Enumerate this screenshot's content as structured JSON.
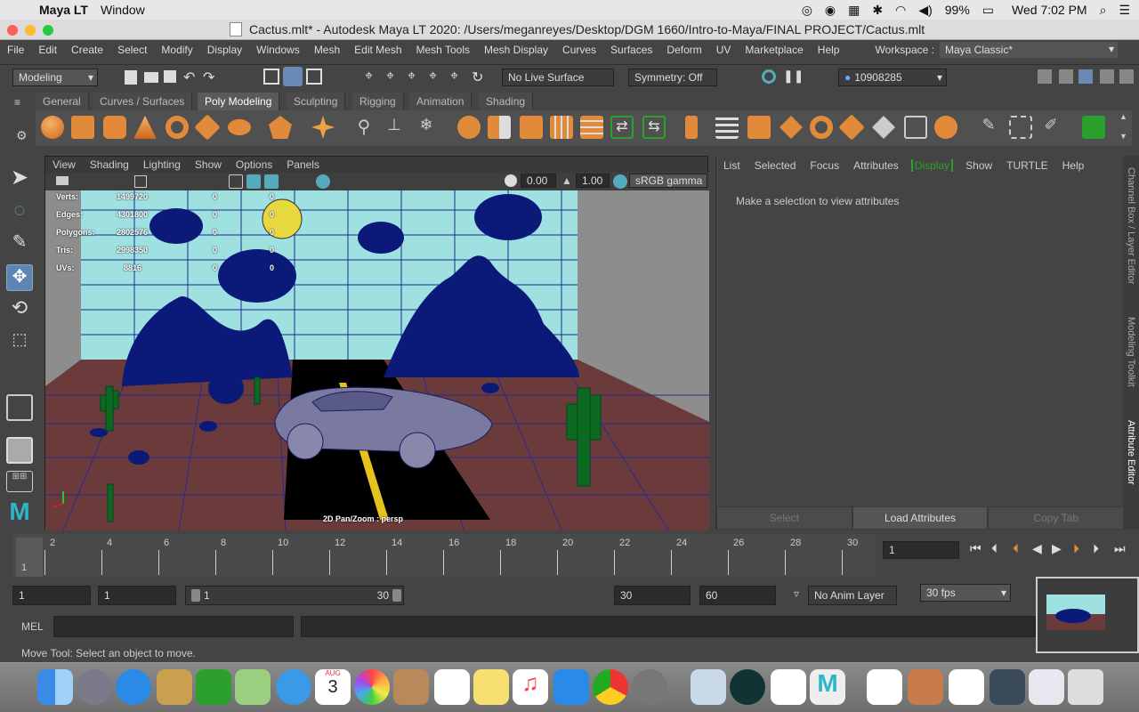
{
  "mac_menubar": {
    "apple": "",
    "app": "Maya LT",
    "window": "Window",
    "battery": "99%",
    "clock": "Wed 7:02 PM"
  },
  "window": {
    "title": "Cactus.mlt* - Autodesk Maya LT 2020: /Users/meganreyes/Desktop/DGM 1660/Intro-to-Maya/FINAL PROJECT/Cactus.mlt"
  },
  "menus": [
    "File",
    "Edit",
    "Create",
    "Select",
    "Modify",
    "Display",
    "Windows",
    "Mesh",
    "Edit Mesh",
    "Mesh Tools",
    "Mesh Display",
    "Curves",
    "Surfaces",
    "Deform",
    "UV",
    "Marketplace",
    "Help"
  ],
  "workspace": {
    "label": "Workspace :",
    "value": "Maya Classic*"
  },
  "status": {
    "mode": "Modeling",
    "live_surface": "No Live Surface",
    "symmetry": "Symmetry: Off",
    "user": "10908285"
  },
  "shelf_tabs": [
    "General",
    "Curves / Surfaces",
    "Poly Modeling",
    "Sculpting",
    "Rigging",
    "Animation",
    "Shading"
  ],
  "shelf_active": "Poly Modeling",
  "viewport": {
    "menus": [
      "View",
      "Shading",
      "Lighting",
      "Show",
      "Options",
      "Panels"
    ],
    "exposure": "0.00",
    "gamma": "1.00",
    "colorspace": "sRGB gamma",
    "hud": [
      {
        "label": "Verts:",
        "value": "1499720",
        "a": "0",
        "b": "0"
      },
      {
        "label": "Edges:",
        "value": "4301800",
        "a": "0",
        "b": "0"
      },
      {
        "label": "Polygons:",
        "value": "2802576",
        "a": "0",
        "b": "0"
      },
      {
        "label": "Tris:",
        "value": "2998350",
        "a": "0",
        "b": "0"
      },
      {
        "label": "UVs:",
        "value": "8816",
        "a": "0",
        "b": "0"
      }
    ],
    "camera_label": "2D Pan/Zoom : persp"
  },
  "attribute_editor": {
    "tabs": [
      "List",
      "Selected",
      "Focus",
      "Attributes",
      "Display",
      "Show",
      "TURTLE",
      "Help"
    ],
    "active_tab": "Display",
    "message": "Make a selection to view attributes",
    "buttons": [
      "Select",
      "Load Attributes",
      "Copy Tab"
    ]
  },
  "side_tabs": [
    "Channel Box / Layer Editor",
    "Modeling Toolkit",
    "Attribute Editor"
  ],
  "timeline": {
    "ticks": [
      "2",
      "4",
      "6",
      "8",
      "10",
      "12",
      "14",
      "16",
      "18",
      "20",
      "22",
      "24",
      "26",
      "28",
      "30"
    ],
    "current": "1",
    "current_field": "1"
  },
  "range": {
    "start": "1",
    "playback_start": "1",
    "slider_start": "1",
    "slider_end": "30",
    "playback_end": "30",
    "end": "60",
    "anim_layer": "No Anim Layer",
    "fps": "30 fps"
  },
  "cmdline": {
    "lang": "MEL"
  },
  "helpline": "Move Tool: Select an object to move.",
  "dock_calendar": {
    "month": "AUG",
    "day": "3"
  },
  "colors": {
    "accent_green": "#2ca02c",
    "sky": "#9fe0e0",
    "floor": "#6b3a3a",
    "rocks": "#0b1a78",
    "ui_bg": "#444444"
  }
}
